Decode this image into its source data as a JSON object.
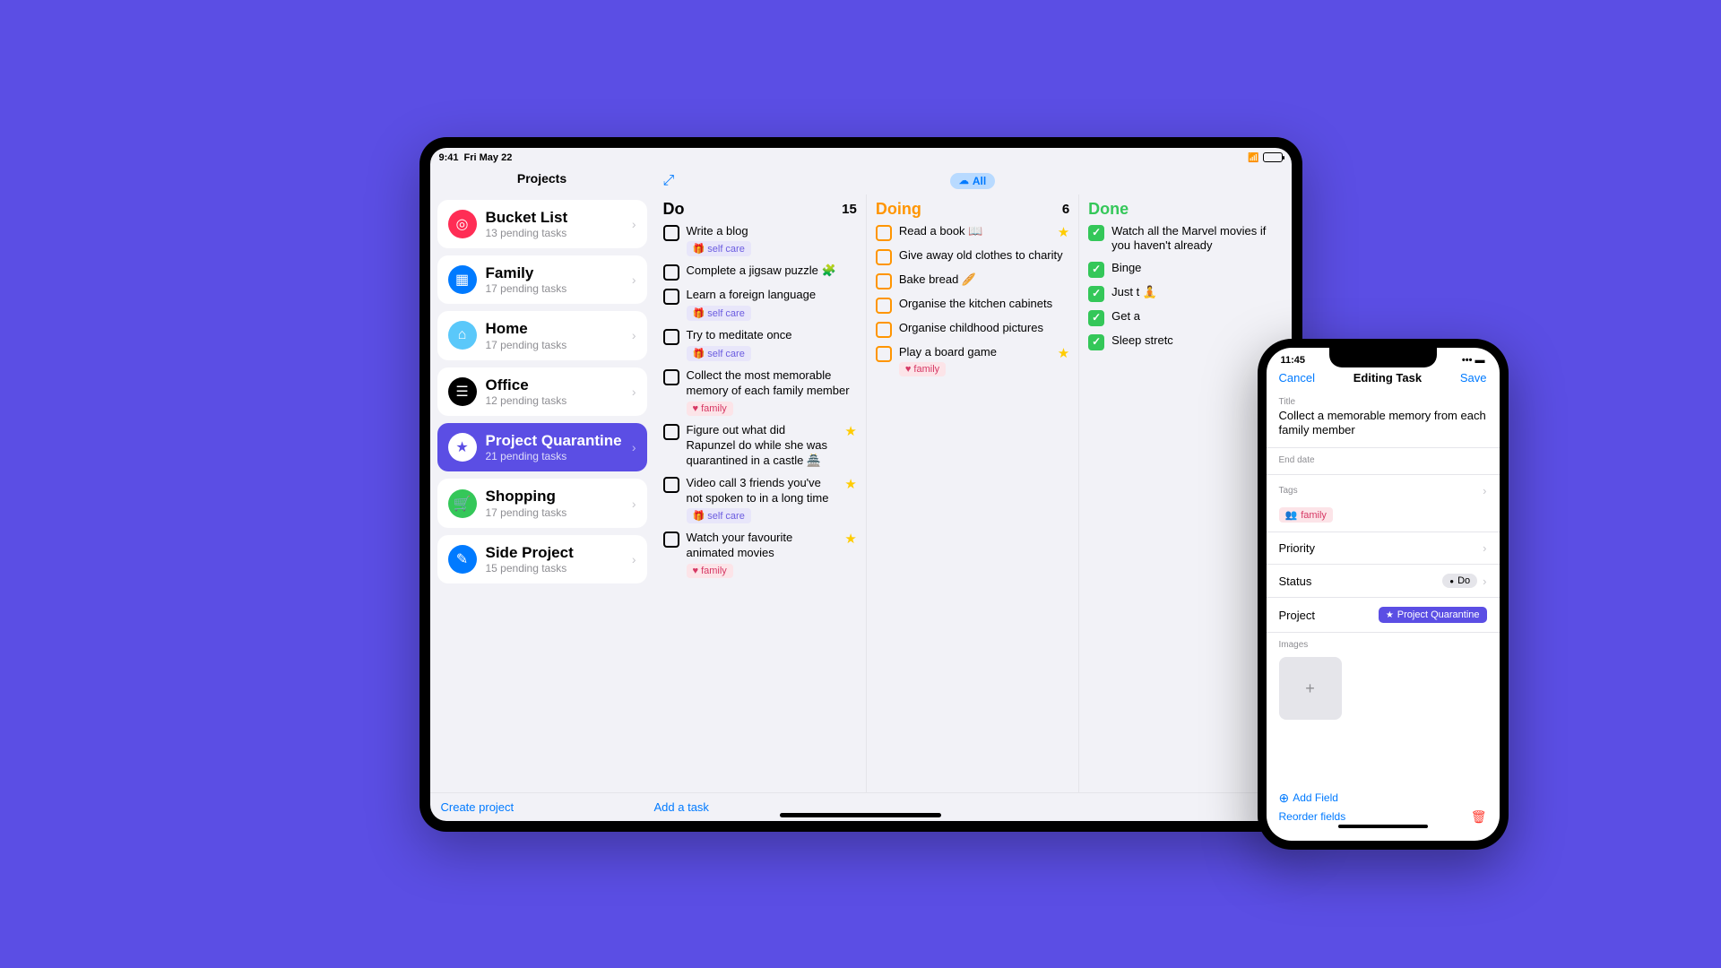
{
  "ipad": {
    "status": {
      "time": "9:41",
      "date": "Fri May 22"
    },
    "sidebar_title": "Projects",
    "all_label": "All",
    "projects": [
      {
        "name": "Bucket List",
        "sub": "13 pending tasks",
        "color": "#ff2d55",
        "icon": "◎"
      },
      {
        "name": "Family",
        "sub": "17 pending tasks",
        "color": "#007aff",
        "icon": "▦"
      },
      {
        "name": "Home",
        "sub": "17 pending tasks",
        "color": "#5ac8fa",
        "icon": "⌂"
      },
      {
        "name": "Office",
        "sub": "12 pending tasks",
        "color": "#000",
        "icon": "☰"
      },
      {
        "name": "Project Quarantine",
        "sub": "21 pending tasks",
        "color": "#5b4ee4",
        "icon": "★",
        "active": true
      },
      {
        "name": "Shopping",
        "sub": "17 pending tasks",
        "color": "#34c759",
        "icon": "🛒"
      },
      {
        "name": "Side Project",
        "sub": "15 pending tasks",
        "color": "#007aff",
        "icon": "✎"
      }
    ],
    "columns": {
      "do": {
        "title": "Do",
        "count": "15",
        "color": "#000",
        "tasks": [
          {
            "title": "Write a blog",
            "tag": "selfcare"
          },
          {
            "title": "Complete a jigsaw puzzle 🧩"
          },
          {
            "title": "Learn a foreign language",
            "tag": "selfcare"
          },
          {
            "title": "Try to meditate once",
            "tag": "selfcare"
          },
          {
            "title": "Collect the most memorable memory of each family member",
            "tag": "family"
          },
          {
            "title": "Figure out what did Rapunzel do while she was quarantined in a castle 🏯",
            "star": true
          },
          {
            "title": "Video call 3 friends you've not spoken to in a long time",
            "tag": "selfcare",
            "star": true
          },
          {
            "title": "Watch your favourite animated movies",
            "tag": "family",
            "star": true
          }
        ]
      },
      "doing": {
        "title": "Doing",
        "count": "6",
        "color": "#ff9500",
        "tasks": [
          {
            "title": "Read a book 📖",
            "star": true
          },
          {
            "title": "Give away old clothes to charity"
          },
          {
            "title": "Bake bread 🥖"
          },
          {
            "title": "Organise the kitchen cabinets"
          },
          {
            "title": "Organise childhood pictures"
          },
          {
            "title": "Play a board game",
            "tag": "family",
            "star": true
          }
        ]
      },
      "done": {
        "title": "Done",
        "color": "#34c759",
        "tasks": [
          {
            "title": "Watch all the Marvel movies if you haven't already"
          },
          {
            "title": "Binge"
          },
          {
            "title": "Just t 🧘"
          },
          {
            "title": "Get a"
          },
          {
            "title": "Sleep stretc"
          }
        ]
      }
    },
    "footer": {
      "create": "Create project",
      "add": "Add a task"
    }
  },
  "iphone": {
    "time": "11:45",
    "nav": {
      "cancel": "Cancel",
      "title": "Editing Task",
      "save": "Save"
    },
    "title_label": "Title",
    "title_value": "Collect a memorable memory from each family member",
    "end_date": "End date",
    "tags_label": "Tags",
    "tag_value": "family",
    "priority": "Priority",
    "status_label": "Status",
    "status_value": "Do",
    "project_label": "Project",
    "project_value": "Project Quarantine",
    "images_label": "Images",
    "add_field": "Add Field",
    "reorder": "Reorder fields"
  },
  "tags": {
    "selfcare_label": "self care",
    "family_label": "family"
  }
}
